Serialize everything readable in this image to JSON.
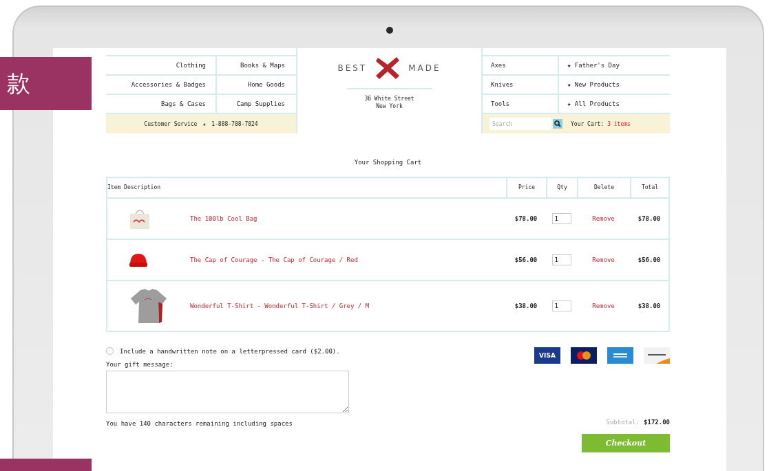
{
  "overlay": {
    "text": "款"
  },
  "nav_left": {
    "rows": [
      [
        "Clothing",
        "Books & Maps"
      ],
      [
        "Accessories & Badges",
        "Home Goods"
      ],
      [
        "Bags & Cases",
        "Camp Supplies"
      ]
    ],
    "service": {
      "label": "Customer Service",
      "star": "★",
      "phone": "1-888-708-7824"
    }
  },
  "logo": {
    "left": "BEST",
    "right": "MADE",
    "address": [
      "36 White Street",
      "New York"
    ]
  },
  "nav_right": {
    "rows": [
      {
        "left": "Axes",
        "star": "★",
        "right": "Father's Day"
      },
      {
        "left": "Knives",
        "star": "★",
        "right": "New Products"
      },
      {
        "left": "Tools",
        "star": "★",
        "right": "All Products"
      }
    ],
    "search": {
      "placeholder": "Search"
    },
    "cart": {
      "label": "Your Cart:",
      "count": "3 items"
    }
  },
  "cart_title": "Your Shopping Cart",
  "table": {
    "columns": [
      "Item Description",
      "Price",
      "Qty",
      "Delete",
      "Total"
    ],
    "rows": [
      {
        "kind": "bag",
        "name": "The 100lb Cool Bag",
        "price": "$78.00",
        "qty": "1",
        "delete": "Remove",
        "total": "$78.00"
      },
      {
        "kind": "cap",
        "name": "The Cap of Courage - The Cap of Courage / Red",
        "price": "$56.00",
        "qty": "1",
        "delete": "Remove",
        "total": "$56.00"
      },
      {
        "kind": "tshirt",
        "name": "Wonderful T-Shirt - Wonderful T-Shirt / Grey / M",
        "price": "$38.00",
        "qty": "1",
        "delete": "Remove",
        "total": "$38.00"
      }
    ]
  },
  "note": {
    "checked": false,
    "label": "Include a handwritten note on a letterpressed card ($2.00)."
  },
  "gift": {
    "label": "Your gift message:",
    "remaining": "You have 140 characters remaining including spaces"
  },
  "payment_cards": [
    {
      "kind": "visa",
      "text": "VISA"
    },
    {
      "kind": "mastercard"
    },
    {
      "kind": "amex"
    },
    {
      "kind": "discover"
    }
  ],
  "subtotal": {
    "label": "Subtotal:",
    "value": "$172.00"
  },
  "checkout": "Checkout"
}
